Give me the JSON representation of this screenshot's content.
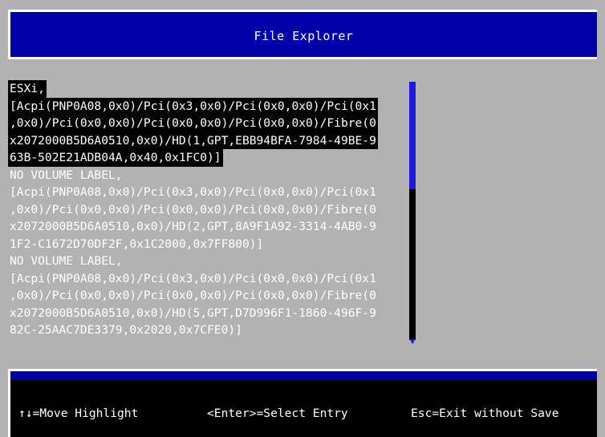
{
  "window": {
    "title": "File Explorer"
  },
  "entries": [
    {
      "lines": [
        "ESXi,",
        "[Acpi(PNP0A08,0x0)/Pci(0x3,0x0)/Pci(0x0,0x0)/Pci(0x1",
        ",0x0)/Pci(0x0,0x0)/Pci(0x0,0x0)/Pci(0x0,0x0)/Fibre(0",
        "x2072000B5D6A0510,0x0)/HD(1,GPT,EBB94BFA-7984-49BE-9",
        "63B-502E21ADB04A,0x40,0x1FC0)]"
      ]
    },
    {
      "lines": [
        "NO VOLUME LABEL,",
        "[Acpi(PNP0A08,0x0)/Pci(0x3,0x0)/Pci(0x0,0x0)/Pci(0x1",
        ",0x0)/Pci(0x0,0x0)/Pci(0x0,0x0)/Pci(0x0,0x0)/Fibre(0",
        "x2072000B5D6A0510,0x0)/HD(2,GPT,8A9F1A92-3314-4AB0-9",
        "1F2-C1672D70DF2F,0x1C2000,0x7FF800)]"
      ]
    },
    {
      "lines": [
        "NO VOLUME LABEL,",
        "[Acpi(PNP0A08,0x0)/Pci(0x3,0x0)/Pci(0x0,0x0)/Pci(0x1",
        ",0x0)/Pci(0x0,0x0)/Pci(0x0,0x0)/Pci(0x0,0x0)/Fibre(0",
        "x2072000B5D6A0510,0x0)/HD(5,GPT,D7D996F1-1860-496F-9",
        "82C-25AAC7DE3379,0x2020,0x7CFE0)]"
      ]
    }
  ],
  "selected_index": 0,
  "scrollbar": {
    "arrow_icon": "down-arrow-icon",
    "thumb_color": "#1a1ae0"
  },
  "status": {
    "move": "↑↓=Move Highlight",
    "select": "<Enter>=Select Entry",
    "exit": "Esc=Exit without Save"
  },
  "colors": {
    "background": "#b2b2b2",
    "title_bar": "#0000aa",
    "highlight": "#000000",
    "text": "#ffffff"
  }
}
